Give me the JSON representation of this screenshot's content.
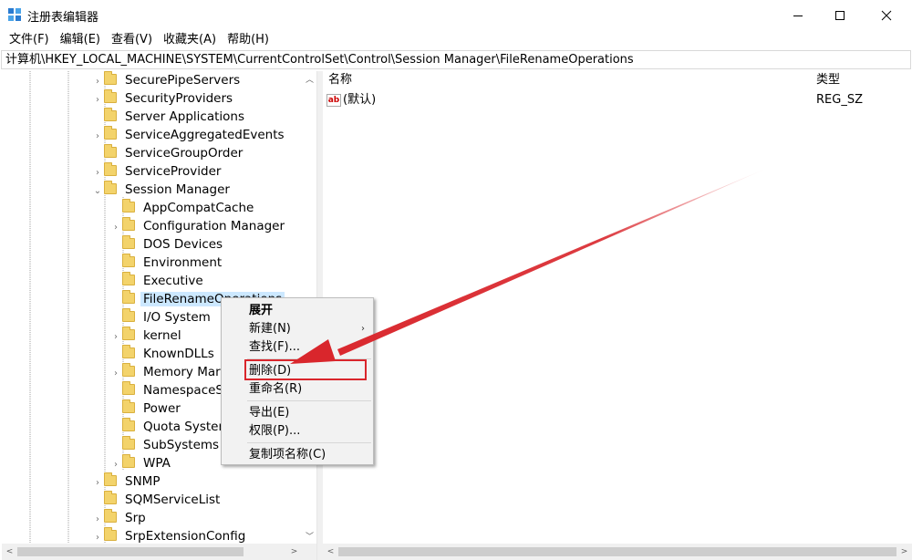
{
  "window": {
    "title": "注册表编辑器",
    "controls": [
      "minimize-icon",
      "maximize-icon",
      "close-icon"
    ]
  },
  "menubar": {
    "items": [
      "文件(F)",
      "编辑(E)",
      "查看(V)",
      "收藏夹(A)",
      "帮助(H)"
    ]
  },
  "address": {
    "path": "计算机\\HKEY_LOCAL_MACHINE\\SYSTEM\\CurrentControlSet\\Control\\Session Manager\\FileRenameOperations"
  },
  "tree": {
    "items": [
      {
        "label": "SecurePipeServers",
        "level": 1,
        "expander": "›"
      },
      {
        "label": "SecurityProviders",
        "level": 1,
        "expander": "›"
      },
      {
        "label": "Server Applications",
        "level": 1,
        "expander": ""
      },
      {
        "label": "ServiceAggregatedEvents",
        "level": 1,
        "expander": "›"
      },
      {
        "label": "ServiceGroupOrder",
        "level": 1,
        "expander": ""
      },
      {
        "label": "ServiceProvider",
        "level": 1,
        "expander": "›"
      },
      {
        "label": "Session Manager",
        "level": 1,
        "expander": "⌄"
      },
      {
        "label": "AppCompatCache",
        "level": 2,
        "expander": ""
      },
      {
        "label": "Configuration Manager",
        "level": 2,
        "expander": "›"
      },
      {
        "label": "DOS Devices",
        "level": 2,
        "expander": ""
      },
      {
        "label": "Environment",
        "level": 2,
        "expander": ""
      },
      {
        "label": "Executive",
        "level": 2,
        "expander": ""
      },
      {
        "label": "FileRenameOperations",
        "level": 2,
        "expander": "",
        "selected": true
      },
      {
        "label": "I/O System",
        "level": 2,
        "expander": ""
      },
      {
        "label": "kernel",
        "level": 2,
        "expander": "›"
      },
      {
        "label": "KnownDLLs",
        "level": 2,
        "expander": ""
      },
      {
        "label": "Memory Mar",
        "level": 2,
        "expander": "›"
      },
      {
        "label": "NamespaceS",
        "level": 2,
        "expander": ""
      },
      {
        "label": "Power",
        "level": 2,
        "expander": ""
      },
      {
        "label": "Quota Syster",
        "level": 2,
        "expander": ""
      },
      {
        "label": "SubSystems",
        "level": 2,
        "expander": ""
      },
      {
        "label": "WPA",
        "level": 2,
        "expander": "›"
      },
      {
        "label": "SNMP",
        "level": 1,
        "expander": "›"
      },
      {
        "label": "SQMServiceList",
        "level": 1,
        "expander": ""
      },
      {
        "label": "Srp",
        "level": 1,
        "expander": "›"
      },
      {
        "label": "SrpExtensionConfig",
        "level": 1,
        "expander": "›"
      }
    ]
  },
  "values": {
    "headers": {
      "name": "名称",
      "type": "类型"
    },
    "rows": [
      {
        "icon": "ab",
        "name": "(默认)",
        "type": "REG_SZ"
      }
    ]
  },
  "context_menu": {
    "items": [
      {
        "label": "展开",
        "kind": "header"
      },
      {
        "label": "新建(N)",
        "kind": "submenu"
      },
      {
        "label": "查找(F)...",
        "kind": "item"
      },
      {
        "label": "删除(D)",
        "kind": "item",
        "highlighted": true
      },
      {
        "label": "重命名(R)",
        "kind": "item"
      },
      {
        "label": "导出(E)",
        "kind": "item"
      },
      {
        "label": "权限(P)...",
        "kind": "item"
      },
      {
        "label": "复制项名称(C)",
        "kind": "item"
      }
    ]
  },
  "colors": {
    "selection": "#cce8ff",
    "annotation_red": "#d9262c",
    "folder": "#f3d36b"
  }
}
